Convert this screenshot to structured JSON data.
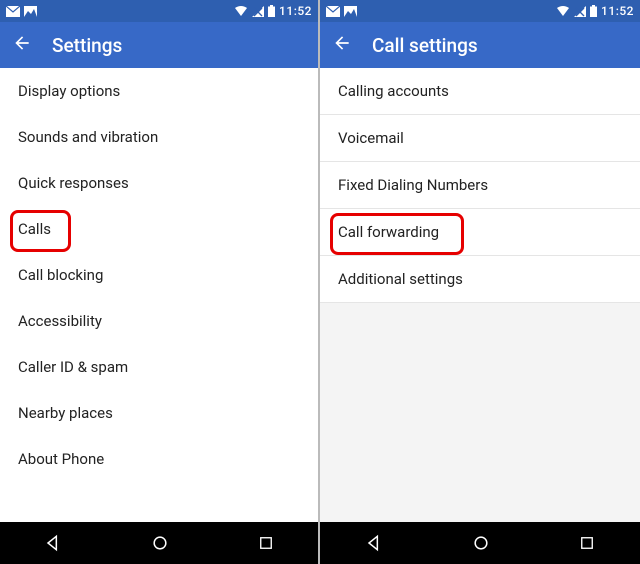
{
  "statusbar": {
    "time": "11:52"
  },
  "screens": [
    {
      "title": "Settings",
      "background": "white",
      "items": [
        {
          "label": "Display options",
          "highlighted": false
        },
        {
          "label": "Sounds and vibration",
          "highlighted": false
        },
        {
          "label": "Quick responses",
          "highlighted": false
        },
        {
          "label": "Calls",
          "highlighted": true
        },
        {
          "label": "Call blocking",
          "highlighted": false
        },
        {
          "label": "Accessibility",
          "highlighted": false
        },
        {
          "label": "Caller ID & spam",
          "highlighted": false
        },
        {
          "label": "Nearby places",
          "highlighted": false
        },
        {
          "label": "About Phone",
          "highlighted": false
        }
      ]
    },
    {
      "title": "Call settings",
      "background": "grey",
      "items": [
        {
          "label": "Calling accounts",
          "highlighted": false
        },
        {
          "label": "Voicemail",
          "highlighted": false
        },
        {
          "label": "Fixed Dialing Numbers",
          "highlighted": false
        },
        {
          "label": "Call forwarding",
          "highlighted": true
        },
        {
          "label": "Additional settings",
          "highlighted": false
        }
      ]
    }
  ]
}
